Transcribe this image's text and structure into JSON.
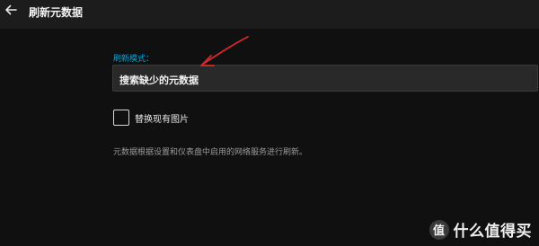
{
  "header": {
    "back_icon": "arrow-left-icon",
    "title": "刷新元数据"
  },
  "form": {
    "refresh_mode": {
      "label": "刷新模式：",
      "selected_value": "搜索缺少的元数据"
    },
    "replace_images": {
      "label": "替换现有图片",
      "checked": false
    },
    "help_text": "元数据根据设置和仪表盘中启用的网络服务进行刷新。"
  },
  "annotation": {
    "color": "#d42a2a"
  },
  "watermark": {
    "logo_text": "值",
    "text": "什么值得买"
  },
  "colors": {
    "accent": "#00a4dc",
    "background": "#101010",
    "topbar": "#1c1c1c"
  }
}
